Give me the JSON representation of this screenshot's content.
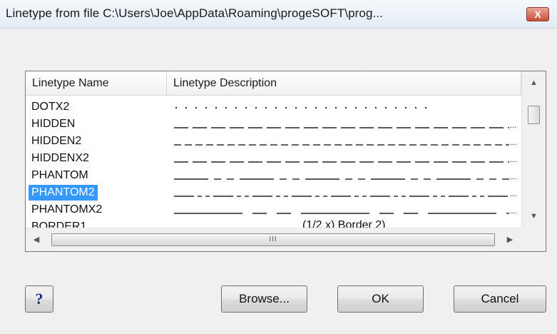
{
  "window": {
    "title": "Linetype from file C:\\Users\\Joe\\AppData\\Roaming\\progeSOFT\\prog...",
    "close_glyph": "X"
  },
  "list": {
    "columns": [
      "Linetype Name",
      "Linetype Description"
    ],
    "rows": [
      {
        "name": "DOTX2",
        "pattern": "dotted"
      },
      {
        "name": "HIDDEN",
        "pattern": "dashed-long"
      },
      {
        "name": "HIDDEN2",
        "pattern": "dashed-short"
      },
      {
        "name": "HIDDENX2",
        "pattern": "dashed-long"
      },
      {
        "name": "PHANTOM",
        "pattern": "phantom"
      },
      {
        "name": "PHANTOM2",
        "pattern": "phantom2"
      },
      {
        "name": "PHANTOMX2",
        "pattern": "phantomx2"
      },
      {
        "name": "BORDER1",
        "pattern": "text"
      }
    ],
    "selected_row": "PHANTOM2",
    "partial_row_desc": "(1/2 x) Border 2)",
    "truncation": "..."
  },
  "scrollbars": {
    "up_icon": "▲",
    "down_icon": "▼",
    "left_icon": "◀",
    "right_icon": "▶",
    "grip": "III"
  },
  "buttons": {
    "help": "?",
    "browse": "Browse...",
    "ok": "OK",
    "cancel": "Cancel"
  },
  "colors": {
    "selection": "#3399ff",
    "help_icon": "#1d2c8f",
    "close_button": "#c8503a"
  }
}
